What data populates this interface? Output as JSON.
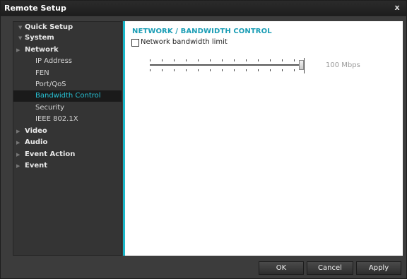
{
  "window": {
    "title": "Remote Setup",
    "close_glyph": "x"
  },
  "sidebar": {
    "items": [
      {
        "label": "Quick Setup",
        "level": "top",
        "arrow": "▼"
      },
      {
        "label": "System",
        "level": "top",
        "arrow": "▼"
      },
      {
        "label": "Network",
        "level": "top",
        "arrow": "▶",
        "expanded": true
      },
      {
        "label": "IP Address",
        "level": "sub"
      },
      {
        "label": "FEN",
        "level": "sub"
      },
      {
        "label": "Port/QoS",
        "level": "sub"
      },
      {
        "label": "Bandwidth Control",
        "level": "sub",
        "selected": true
      },
      {
        "label": "Security",
        "level": "sub"
      },
      {
        "label": "IEEE 802.1X",
        "level": "sub"
      },
      {
        "label": "Video",
        "level": "top",
        "arrow": "▶"
      },
      {
        "label": "Audio",
        "level": "top",
        "arrow": "▶"
      },
      {
        "label": "Event Action",
        "level": "top",
        "arrow": "▶"
      },
      {
        "label": "Event",
        "level": "top",
        "arrow": "▶"
      }
    ]
  },
  "content": {
    "section_title": "NETWORK / BANDWIDTH CONTROL",
    "bandwidth_limit": {
      "label": "Network bandwidth limit",
      "checked": false
    },
    "slider": {
      "value_label": "100 Mbps",
      "fraction": 1.0
    }
  },
  "footer": {
    "ok_label": "OK",
    "cancel_label": "Cancel",
    "apply_label": "Apply"
  },
  "colors": {
    "accent": "#1ab6c8",
    "selected_text": "#27c3d6",
    "section_title": "#1a9db5"
  }
}
